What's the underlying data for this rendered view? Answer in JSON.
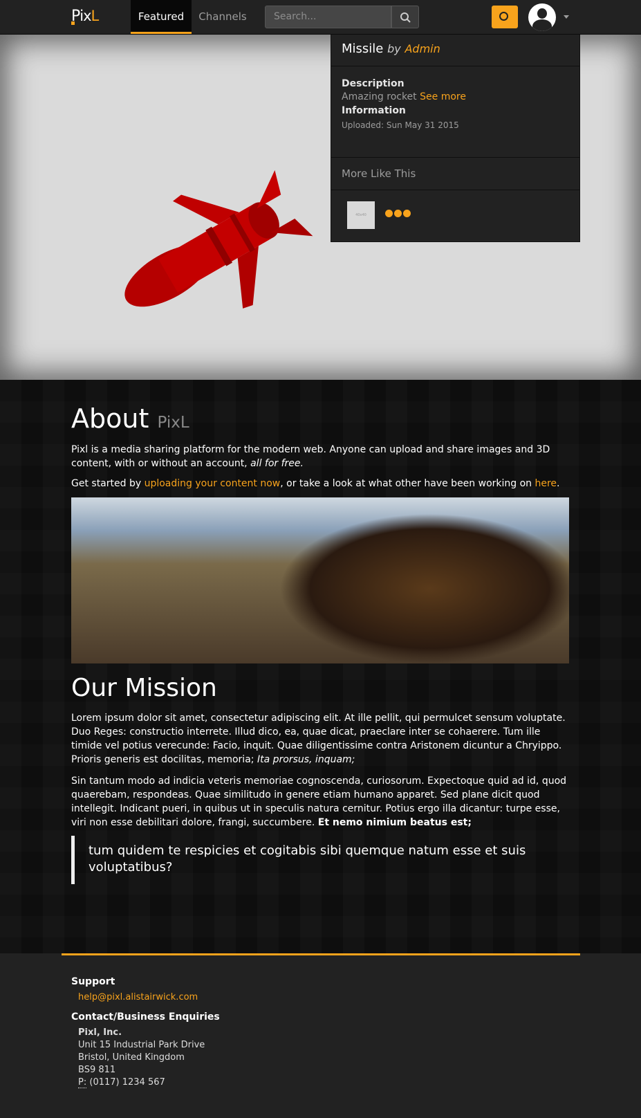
{
  "navbar": {
    "brand": "PixL",
    "tabs": [
      {
        "label": "Featured",
        "active": true
      },
      {
        "label": "Channels",
        "active": false
      }
    ],
    "search_placeholder": "Search...",
    "accent": "#f8a31c"
  },
  "viewer": {
    "model_title": "Missile",
    "by_label": "by",
    "author": "Admin",
    "description_label": "Description",
    "description_text": "Amazing rocket",
    "see_more": "See more",
    "information_label": "Information",
    "uploaded": "Uploaded: Sun May 31 2015",
    "more_like_this": "More Like This",
    "thumb_label": "40x40"
  },
  "about": {
    "title": "About",
    "subtitle": "PixL",
    "intro": "Pixl is a media sharing platform for the modern web. Anyone can upload and share images and 3D content, with or without an account,",
    "intro_em": "all for free.",
    "get_started_prefix": "Get started by",
    "upload_link": "uploading your content now",
    "get_started_mid": ", or take a look at what other have been working on",
    "here_link": "here",
    "get_started_end": ".",
    "mission_title": "Our Mission",
    "mission_p1": "Lorem ipsum dolor sit amet, consectetur adipiscing elit. At ille pellit, qui permulcet sensum voluptate. Duo Reges: constructio interrete. Illud dico, ea, quae dicat, praeclare inter se cohaerere. Tum ille timide vel potius verecunde: Facio, inquit. Quae diligentissime contra Aristonem dicuntur a Chryippo. Prioris generis est docilitas, memoria;",
    "mission_p1_em": "Ita prorsus, inquam;",
    "mission_p2": "Sin tantum modo ad indicia veteris memoriae cognoscenda, curiosorum. Expectoque quid ad id, quod quaerebam, respondeas. Quae similitudo in genere etiam humano apparet. Sed plane dicit quod intellegit. Indicant pueri, in quibus ut in speculis natura cernitur. Potius ergo illa dicantur: turpe esse, viri non esse debilitari dolore, frangi, succumbere.",
    "mission_p2_strong": "Et nemo nimium beatus est;",
    "quote": "tum quidem te respicies et cogitabis sibi quemque natum esse et suis voluptatibus?"
  },
  "footer": {
    "support_label": "Support",
    "support_email": "help@pixl.alistairwick.com",
    "contact_label": "Contact/Business Enquiries",
    "company": "Pixl, Inc.",
    "address1": "Unit 15 Industrial Park Drive",
    "address2": "Bristol, United Kingdom",
    "postcode": "BS9 811",
    "phone_label": "P:",
    "phone": "(0117) 1234 567"
  }
}
